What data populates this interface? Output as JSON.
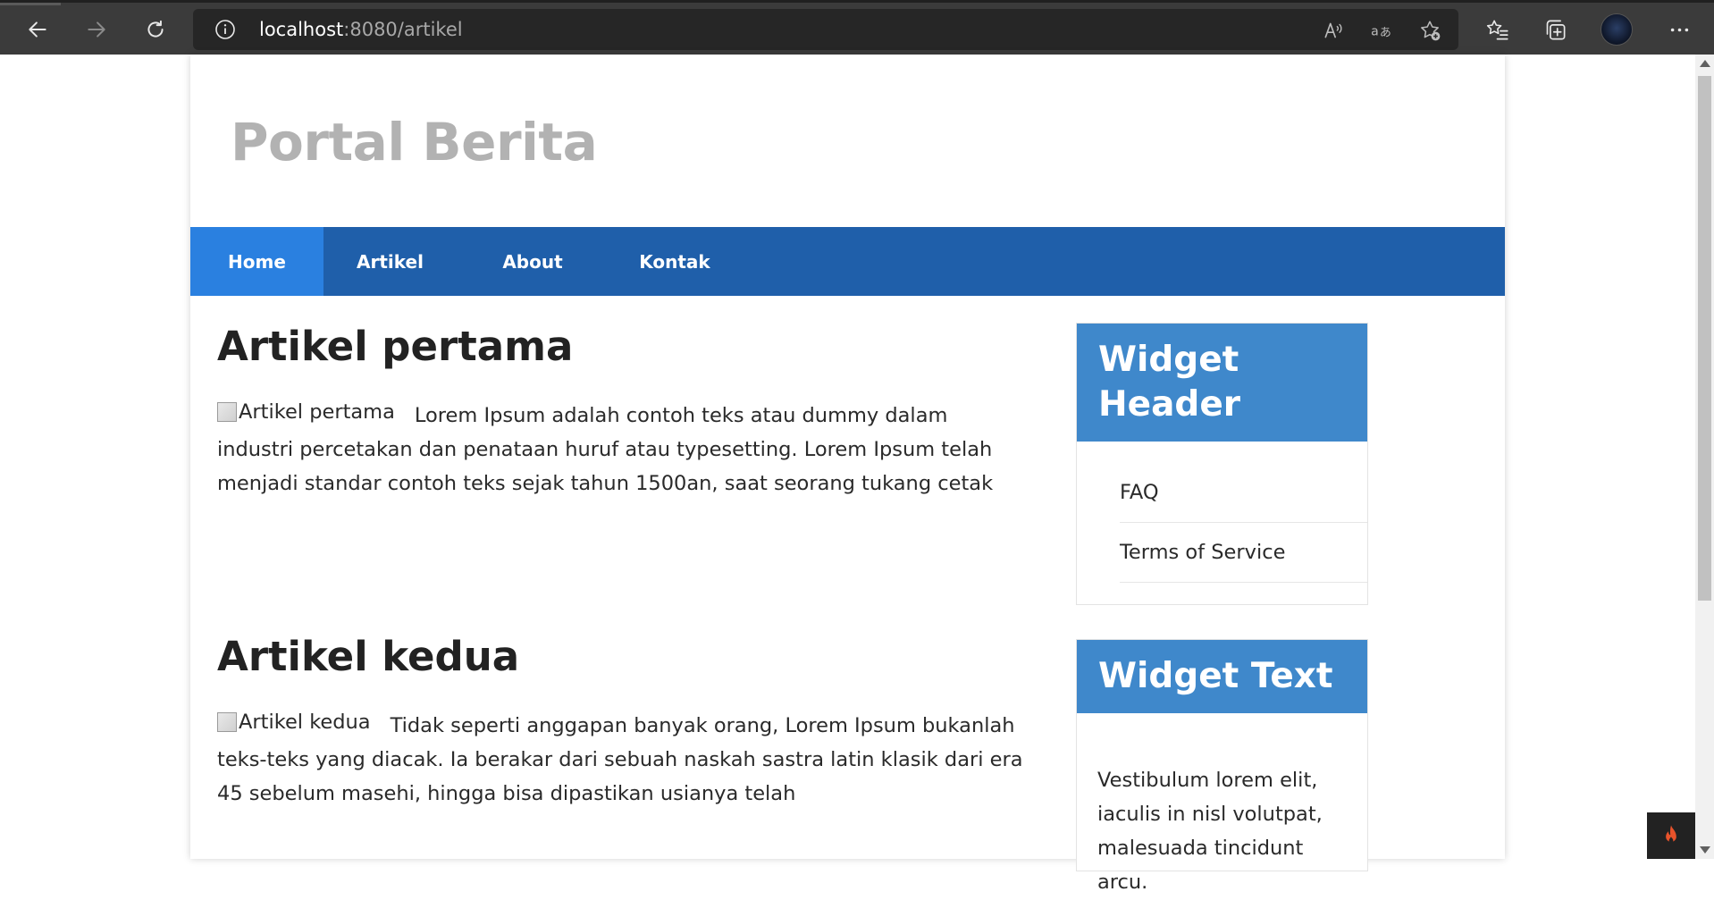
{
  "browser": {
    "url_host": "localhost",
    "url_rest": ":8080/artikel"
  },
  "site": {
    "title": "Portal Berita"
  },
  "nav": {
    "items": [
      {
        "label": "Home",
        "active": true
      },
      {
        "label": "Artikel",
        "active": false
      },
      {
        "label": "About",
        "active": false
      },
      {
        "label": "Kontak",
        "active": false
      }
    ]
  },
  "articles": [
    {
      "title": "Artikel pertama",
      "image_alt": "Artikel pertama",
      "body": "Lorem Ipsum adalah contoh teks atau dummy dalam industri percetakan dan penataan huruf atau typesetting. Lorem Ipsum telah menjadi standar contoh teks sejak tahun 1500an, saat seorang tukang cetak"
    },
    {
      "title": "Artikel kedua",
      "image_alt": "Artikel kedua",
      "body": "Tidak seperti anggapan banyak orang, Lorem Ipsum bukanlah teks-teks yang diacak. Ia berakar dari sebuah naskah sastra latin klasik dari era 45 sebelum masehi, hingga bisa dipastikan usianya telah"
    }
  ],
  "widgets": {
    "header_widget": {
      "title": "Widget Header",
      "links": [
        "FAQ",
        "Terms of Service"
      ]
    },
    "text_widget": {
      "title": "Widget Text",
      "body": "Vestibulum lorem elit, iaculis in nisl volutpat, malesuada tincidunt arcu."
    }
  },
  "colors": {
    "nav_bg": "#1f5faa",
    "nav_active": "#2a80e0",
    "widget_header": "#3f88cb",
    "site_title": "#b2b2b2"
  }
}
